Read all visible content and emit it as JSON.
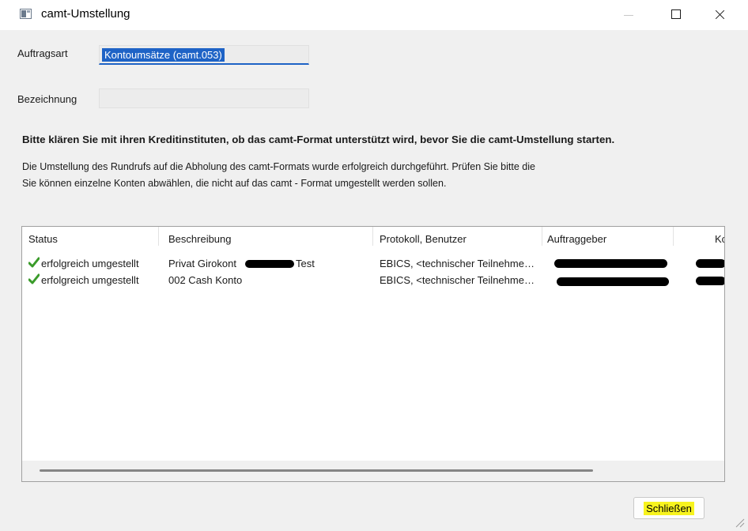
{
  "window": {
    "title": "camt-Umstellung",
    "icon": "app-window-icon"
  },
  "form": {
    "auftragsart_label": "Auftragsart",
    "auftragsart_value": "Kontoumsätze (camt.053)",
    "bezeichnung_label": "Bezeichnung",
    "bezeichnung_value": ""
  },
  "messages": {
    "warning": "Bitte klären Sie mit ihren Kreditinstituten, ob das camt-Format unterstützt wird, bevor Sie die camt-Umstellung starten.",
    "info_line1": "Die Umstellung des Rundrufs auf die Abholung des camt-Formats wurde erfolgreich durchgeführt. Prüfen Sie bitte die",
    "info_line2": "Sie können einzelne Konten abwählen, die nicht auf das camt - Format umgestellt werden sollen."
  },
  "table": {
    "columns": [
      "Status",
      "Beschreibung",
      "Protokoll, Benutzer",
      "Auftraggeber",
      "Kc"
    ],
    "rows": [
      {
        "status": "erfolgreich umgestellt",
        "beschreibung_prefix": "Privat Girokont",
        "beschreibung_suffix": "Test",
        "protokoll": "EBICS, <technischer Teilnehme…"
      },
      {
        "status": "erfolgreich umgestellt",
        "beschreibung_prefix": "002 Cash Konto",
        "beschreibung_suffix": "",
        "protokoll": "EBICS, <technischer Teilnehme…"
      }
    ],
    "status_icon": "green-checkmark-icon",
    "status_color": "#3a9b2a"
  },
  "footer": {
    "close_label": "Schließen",
    "highlight_color": "#f7f31e"
  }
}
